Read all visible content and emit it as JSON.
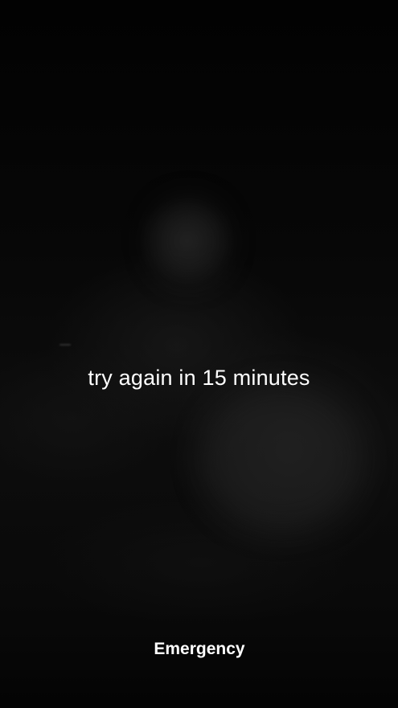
{
  "lock_screen": {
    "message": "try again in 15 minutes",
    "emergency_label": "Emergency"
  },
  "colors": {
    "background": "#050505",
    "text": "#ffffff"
  }
}
